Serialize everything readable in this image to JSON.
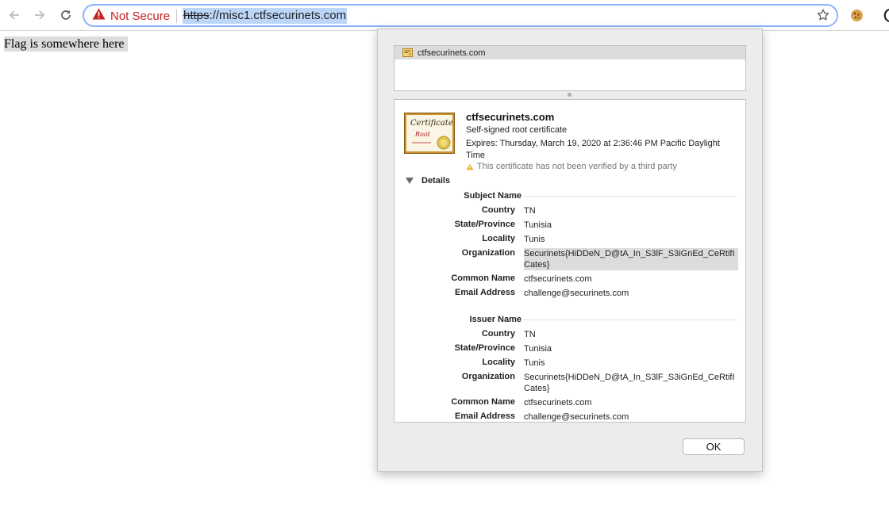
{
  "browser": {
    "security_label": "Not Secure",
    "url_scheme": "https",
    "url_rest": "://misc1.ctfsecurinets.com",
    "colors": {
      "security_red": "#c5221f",
      "url_highlight": "#bcd6f7",
      "omnibox_border": "#8ab4f8"
    },
    "icons": [
      "back-arrow-icon",
      "forward-arrow-icon",
      "reload-icon",
      "warning-triangle-icon",
      "star-icon",
      "cookie-extension-icon"
    ]
  },
  "page": {
    "text": "Flag is somewhere here"
  },
  "cert_dialog": {
    "list_item": "ctfsecurinets.com",
    "cert_name": "ctfsecurinets.com",
    "cert_type": "Self-signed root certificate",
    "expires": "Expires: Thursday, March 19, 2020 at 2:36:46 PM Pacific Daylight Time",
    "warning": "This certificate has not been verified by a third party",
    "details_label": "Details",
    "thumb_title": "Certificate",
    "thumb_sub": "Root",
    "subject": {
      "heading": "Subject Name",
      "fields": [
        {
          "key": "Country",
          "value": "TN"
        },
        {
          "key": "State/Province",
          "value": "Tunisia"
        },
        {
          "key": "Locality",
          "value": "Tunis"
        },
        {
          "key": "Organization",
          "value": "Securinets{HiDDeN_D@tA_In_S3lF_S3iGnEd_CeRtifICates}"
        },
        {
          "key": "Common Name",
          "value": "ctfsecurinets.com"
        },
        {
          "key": "Email Address",
          "value": "challenge@securinets.com"
        }
      ]
    },
    "issuer": {
      "heading": "Issuer Name",
      "fields": [
        {
          "key": "Country",
          "value": "TN"
        },
        {
          "key": "State/Province",
          "value": "Tunisia"
        },
        {
          "key": "Locality",
          "value": "Tunis"
        },
        {
          "key": "Organization",
          "value": "Securinets{HiDDeN_D@tA_In_S3lF_S3iGnEd_CeRtifICates}"
        },
        {
          "key": "Common Name",
          "value": "ctfsecurinets.com"
        },
        {
          "key": "Email Address",
          "value": "challenge@securinets.com"
        }
      ]
    },
    "ok_label": "OK"
  }
}
